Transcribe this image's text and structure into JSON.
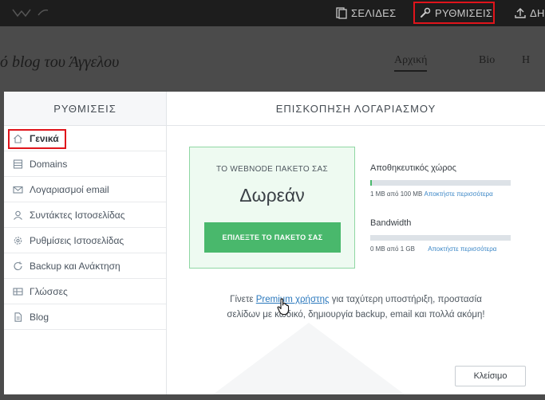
{
  "topbar": {
    "pages_label": "ΣΕΛΙΔΕΣ",
    "settings_label": "ΡΥΘΜΙΣΕΙΣ",
    "publish_label": "ΔΗ"
  },
  "page": {
    "blog_title": "ό blog του Άγγελου",
    "nav": [
      "Αρχική",
      "Bio",
      "Η"
    ]
  },
  "sidebar": {
    "header": "ΡΥΘΜΙΣΕΙΣ",
    "items": [
      {
        "label": "Γενικά",
        "icon": "home-icon"
      },
      {
        "label": "Domains",
        "icon": "server-icon"
      },
      {
        "label": "Λογαριασμοί email",
        "icon": "envelope-icon"
      },
      {
        "label": "Συντάκτες Ιστοσελίδας",
        "icon": "user-icon"
      },
      {
        "label": "Ρυθμίσεις Ιστοσελίδας",
        "icon": "gear-icon"
      },
      {
        "label": "Backup και Ανάκτηση",
        "icon": "refresh-icon"
      },
      {
        "label": "Γλώσσες",
        "icon": "languages-icon"
      },
      {
        "label": "Blog",
        "icon": "document-icon"
      }
    ],
    "active_index": 0
  },
  "main": {
    "header": "ΕΠΙΣΚΟΠΗΣΗ ΛΟΓΑΡΙΑΣΜΟΥ",
    "package": {
      "label": "ΤΟ WEBNODE ΠΑΚΕΤΟ ΣΑΣ",
      "plan": "Δωρεάν",
      "button": "ΕΠΙΛΕΞΤΕ ΤΟ ΠΑΚΕΤΟ ΣΑΣ"
    },
    "storage": {
      "label": "Αποθηκευτικός χώρος",
      "usage": "1 MB από 100 MB",
      "link": "Αποκτήστε περισσότερα",
      "fill_fraction": 0.01
    },
    "bandwidth": {
      "label": "Bandwidth",
      "usage": "0 MB από 1 GB",
      "link": "Αποκτήστε περισσότερα",
      "fill_fraction": 0.0
    },
    "promo": {
      "before": "Γίνετε ",
      "link": "Premium χρήστης",
      "after": " για ταχύτερη υποστήριξη, προστασία",
      "line2": "σελίδων με κωδικό, δημιουργία backup, email και πολλά ακόμη!"
    },
    "close_button": "Κλείσιμο"
  },
  "colors": {
    "accent_green": "#49b86c",
    "highlight_red": "#e0141b",
    "link_blue": "#2a78bd"
  }
}
